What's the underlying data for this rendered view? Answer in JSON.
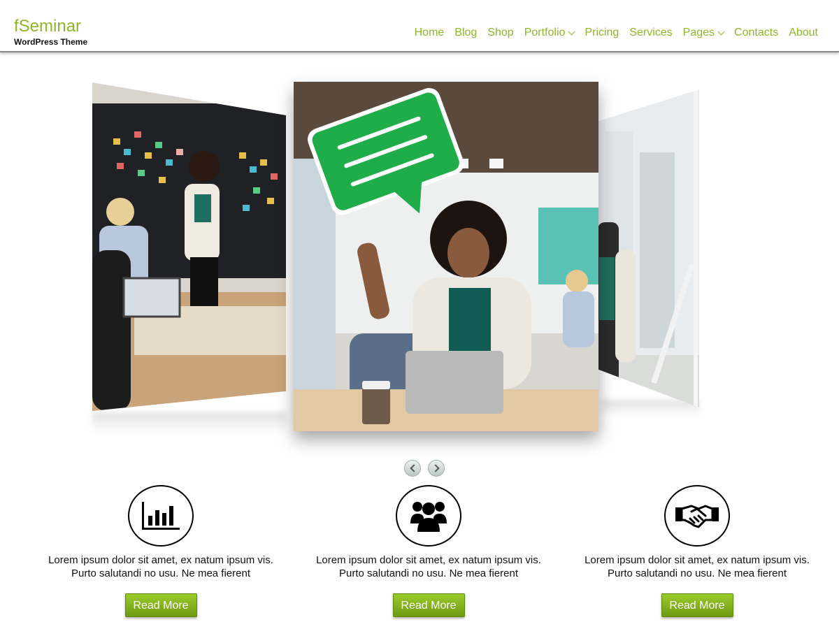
{
  "site": {
    "title": "fSeminar",
    "subtitle": "WordPress Theme",
    "accent_color": "#8db528"
  },
  "nav": {
    "items": [
      {
        "label": "Home",
        "has_dropdown": false
      },
      {
        "label": "Blog",
        "has_dropdown": false
      },
      {
        "label": "Shop",
        "has_dropdown": false
      },
      {
        "label": "Portfolio",
        "has_dropdown": true
      },
      {
        "label": "Pricing",
        "has_dropdown": false
      },
      {
        "label": "Services",
        "has_dropdown": false
      },
      {
        "label": "Pages",
        "has_dropdown": true
      },
      {
        "label": "Contacts",
        "has_dropdown": false
      },
      {
        "label": "About",
        "has_dropdown": false
      }
    ]
  },
  "slider": {
    "slides": [
      {
        "icon": "meeting-photo"
      },
      {
        "icon": "woman-with-chat-bubble-photo"
      },
      {
        "icon": "city-street-photo"
      }
    ],
    "prev_icon": "chevron-left-icon",
    "next_icon": "chevron-right-icon"
  },
  "features": [
    {
      "icon": "bar-chart-icon",
      "text_line1": "Lorem ipsum dolor sit amet, ex natum ipsum vis.",
      "text_line2": "Purto salutandi no usu. Ne mea fierent",
      "button": "Read More"
    },
    {
      "icon": "users-group-icon",
      "text_line1": "Lorem ipsum dolor sit amet, ex natum ipsum vis.",
      "text_line2": "Purto salutandi no usu. Ne mea fierent",
      "button": "Read More"
    },
    {
      "icon": "handshake-icon",
      "text_line1": "Lorem ipsum dolor sit amet, ex natum ipsum vis.",
      "text_line2": "Purto salutandi no usu. Ne mea fierent",
      "button": "Read More"
    }
  ]
}
